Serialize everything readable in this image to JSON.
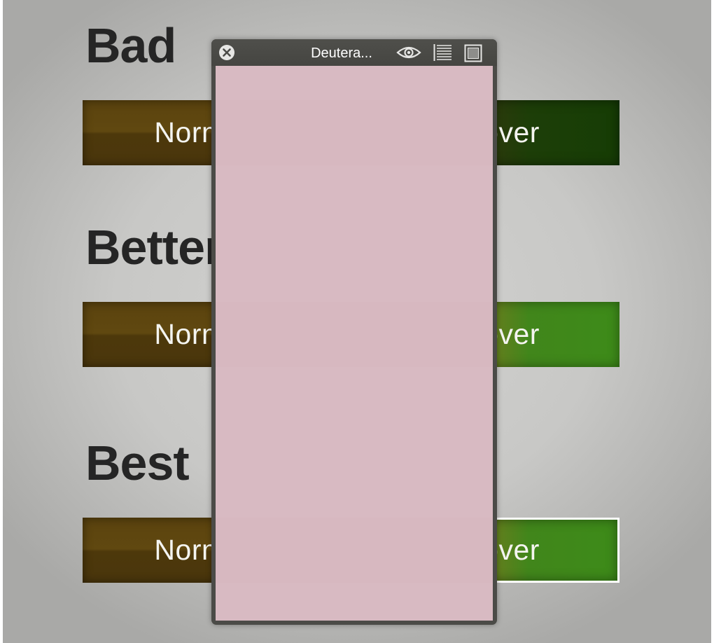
{
  "sections": [
    {
      "heading": "Bad",
      "normal_label": "Normal",
      "hover_label": "Hover"
    },
    {
      "heading": "Better",
      "normal_label": "Normal",
      "hover_label": "Hover"
    },
    {
      "heading": "Best",
      "normal_label": "Normal",
      "hover_label": "Hover"
    }
  ],
  "filter_window": {
    "title": "Deutera...",
    "icons": [
      "close-icon",
      "eye-icon",
      "list-icon",
      "square-icon"
    ],
    "overlay_color": "#dcbdc5"
  },
  "colors": {
    "normal_button": "#5a420e",
    "bad_hover": "#1a3e07",
    "bright_hover_green": "#3d8b19",
    "bright_hover_orange": "#936f20",
    "heading_text": "#252525"
  }
}
